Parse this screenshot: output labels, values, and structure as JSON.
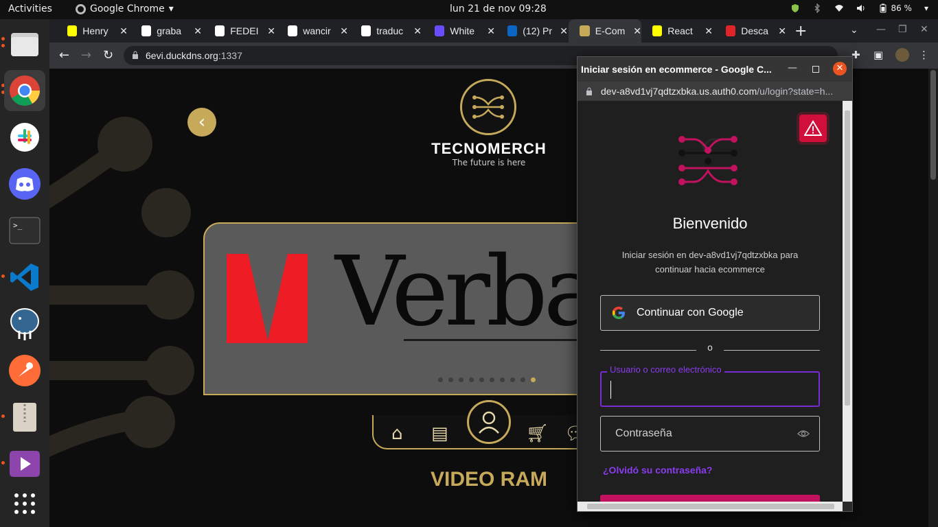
{
  "topbar": {
    "activities": "Activities",
    "app_name": "Google Chrome",
    "clock": "lun 21 de nov  09:28",
    "battery": "86 %"
  },
  "dock": {
    "items": [
      "files-icon",
      "chrome-icon",
      "slack-icon",
      "discord-icon",
      "terminal-icon",
      "vscode-icon",
      "postgresql-icon",
      "postman-icon",
      "archive-icon",
      "video-player-icon",
      "show-apps-icon"
    ]
  },
  "tabs": [
    {
      "label": "Henry",
      "favicon_color": "#ffff01"
    },
    {
      "label": "graba",
      "favicon_color": "#ffffff"
    },
    {
      "label": "FEDEI",
      "favicon_color": "#ffffff"
    },
    {
      "label": "wancir",
      "favicon_color": "#ffffff"
    },
    {
      "label": "traduc",
      "favicon_color": "#ffffff"
    },
    {
      "label": "White",
      "favicon_color": "#6a4cff"
    },
    {
      "label": "(12) Pr",
      "favicon_color": "#0a66c2"
    },
    {
      "label": "E-Com",
      "favicon_color": "#c7a95a"
    },
    {
      "label": "React",
      "favicon_color": "#ffff01"
    },
    {
      "label": "Desca",
      "favicon_color": "#e0252a"
    }
  ],
  "address": {
    "host": "6evi.duckdns.org",
    "port": ":1337"
  },
  "page": {
    "brand": "TECNOMERCH",
    "tagline": "The future is here",
    "carousel_text": "Verba",
    "section_title": "VIDEO RAM",
    "carousel_dots": 10,
    "active_dot": 9,
    "accent_color": "#c7a95a"
  },
  "popup": {
    "title": "Iniciar sesión en ecommerce - Google C...",
    "url_host": "dev-a8vd1vj7qdtzxbka.us.auth0.com",
    "url_path": "/u/login?state=h...",
    "welcome": "Bienvenido",
    "subtitle": "Iniciar sesión en dev-a8vd1vj7qdtzxbka para continuar hacia ecommerce",
    "google_button": "Continuar con Google",
    "divider": "o",
    "username_label": "Usuario o correo electrónico",
    "username_value": "",
    "password_placeholder": "Contraseña",
    "forgot_password": "¿Olvidó su contraseña?",
    "accent_color": "#8b3cf0",
    "button_color": "#c2115f"
  }
}
